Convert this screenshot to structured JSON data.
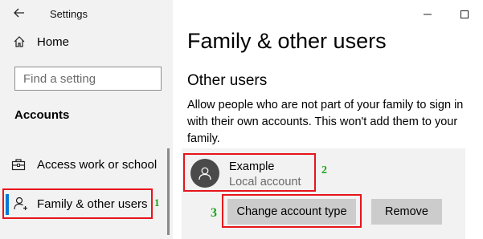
{
  "window": {
    "title": "Settings"
  },
  "sidebar": {
    "home_label": "Home",
    "search_placeholder": "Find a setting",
    "section_heading": "Accounts",
    "items": [
      {
        "label": "Access work or school",
        "icon": "briefcase-icon"
      },
      {
        "label": "Family & other users",
        "icon": "person-add-icon",
        "selected": true
      }
    ]
  },
  "main": {
    "title": "Family & other users",
    "section_title": "Other users",
    "description": "Allow people who are not part of your family to sign in with their own accounts. This won't add them to your family.",
    "account": {
      "name": "Example",
      "type": "Local account",
      "avatar_icon": "user-avatar-icon"
    },
    "buttons": {
      "change_account_type": "Change account type",
      "remove": "Remove"
    }
  },
  "callouts": {
    "one": "1",
    "two": "2",
    "three": "3"
  },
  "colors": {
    "accent": "#0078d7",
    "highlight_box": "#e8141b",
    "callout_text": "#1aa31a",
    "sidebar_bg": "#f2f2f2",
    "button_bg": "#cccccc"
  }
}
